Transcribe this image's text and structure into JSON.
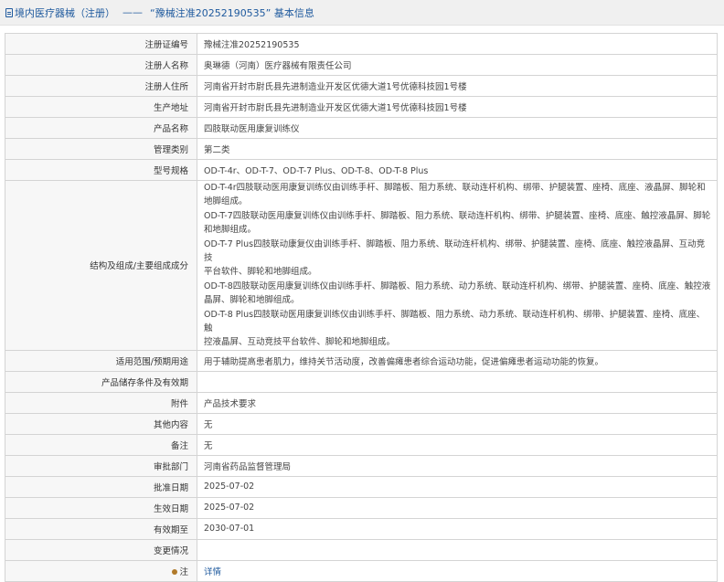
{
  "header": {
    "breadcrumb_root": "境内医疗器械（注册）",
    "separator": "——",
    "record_title": "“豫械注准20252190535” 基本信息"
  },
  "rows": [
    {
      "label": "注册证编号",
      "value": "豫械注准20252190535"
    },
    {
      "label": "注册人名称",
      "value": "奥琳德（河南）医疗器械有限责任公司"
    },
    {
      "label": "注册人住所",
      "value": "河南省开封市尉氏县先进制造业开发区优德大道1号优德科技园1号楼"
    },
    {
      "label": "生产地址",
      "value": "河南省开封市尉氏县先进制造业开发区优德大道1号优德科技园1号楼"
    },
    {
      "label": "产品名称",
      "value": "四肢联动医用康复训练仪"
    },
    {
      "label": "管理类别",
      "value": "第二类"
    },
    {
      "label": "型号规格",
      "value": "OD-T-4r、OD-T-7、OD-T-7 Plus、OD-T-8、OD-T-8 Plus"
    }
  ],
  "structure": {
    "label": "结构及组成/主要组成成分",
    "lines": [
      "OD-T-4r四肢联动医用康复训练仪由训练手杆、脚踏板、阻力系统、联动连杆机构、绑带、护腿装置、座椅、底座、液晶屏、脚轮和",
      "地脚组成。",
      "OD-T-7四肢联动医用康复训练仪由训练手杆、脚踏板、阻力系统、联动连杆机构、绑带、护腿装置、座椅、底座、触控液晶屏、脚轮",
      "和地脚组成。",
      "OD-T-7 Plus四肢联动康复仪由训练手杆、脚踏板、阻力系统、联动连杆机构、绑带、护腿装置、座椅、底座、触控液晶屏、互动竞技",
      "平台软件、脚轮和地脚组成。",
      "OD-T-8四肢联动医用康复训练仪由训练手杆、脚踏板、阻力系统、动力系统、联动连杆机构、绑带、护腿装置、座椅、底座、触控液",
      "晶屏、脚轮和地脚组成。",
      "OD-T-8 Plus四肢联动医用康复训练仪由训练手杆、脚踏板、阻力系统、动力系统、联动连杆机构、绑带、护腿装置、座椅、底座、触",
      "控液晶屏、互动竞技平台软件、脚轮和地脚组成。"
    ]
  },
  "rows2": [
    {
      "label": "适用范围/预期用途",
      "value": "用于辅助提高患者肌力，维持关节活动度，改善偏瘫患者综合运动功能，促进偏瘫患者运动功能的恢复。"
    },
    {
      "label": "产品储存条件及有效期",
      "value": ""
    },
    {
      "label": "附件",
      "value": "产品技术要求"
    },
    {
      "label": "其他内容",
      "value": "无"
    },
    {
      "label": "备注",
      "value": "无"
    },
    {
      "label": "审批部门",
      "value": "河南省药品监督管理局"
    },
    {
      "label": "批准日期",
      "value": "2025-07-02"
    },
    {
      "label": "生效日期",
      "value": "2025-07-02"
    },
    {
      "label": "有效期至",
      "value": "2030-07-01"
    },
    {
      "label": "变更情况",
      "value": ""
    }
  ],
  "note_row": {
    "label": "注",
    "link": "详情",
    "icon": "pin-icon"
  }
}
